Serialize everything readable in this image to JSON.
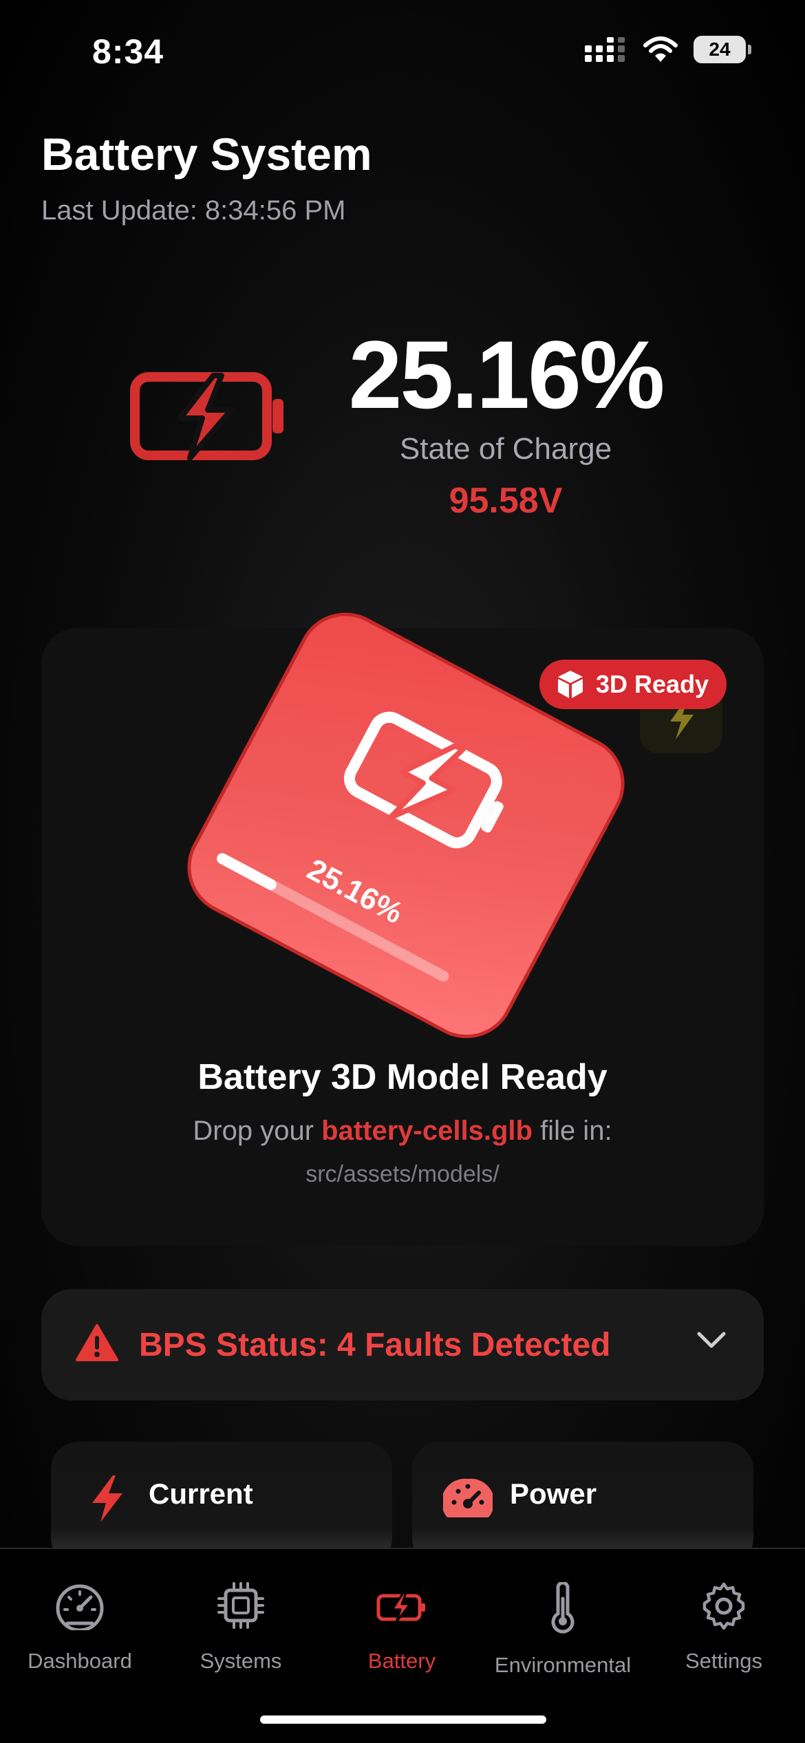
{
  "status_bar": {
    "time": "8:34",
    "battery_level": "24"
  },
  "header": {
    "title": "Battery System",
    "last_update": "Last Update: 8:34:56 PM"
  },
  "soc": {
    "value": "25.16%",
    "label": "State of Charge",
    "voltage": "95.58V"
  },
  "model_card": {
    "badge": "3D Ready",
    "cube_percent": "25.16%",
    "cube_progress": 0.2516,
    "title": "Battery 3D Model Ready",
    "drop_prefix": "Drop your",
    "drop_file": "battery-cells.glb",
    "drop_suffix": "file in:",
    "path": "src/assets/models/"
  },
  "bps": {
    "status": "BPS Status: 4 Faults Detected"
  },
  "metrics": {
    "current_label": "Current",
    "power_label": "Power"
  },
  "tabs": [
    {
      "label": "Dashboard",
      "icon": "gauge-icon"
    },
    {
      "label": "Systems",
      "icon": "cpu-chip-icon"
    },
    {
      "label": "Battery",
      "icon": "battery-charging-icon",
      "active": true
    },
    {
      "label": "Environmental",
      "icon": "thermometer-icon"
    },
    {
      "label": "Settings",
      "icon": "gear-icon"
    }
  ],
  "colors": {
    "accent": "#e03a3a",
    "badge": "#d7282f",
    "cube": "#ef4a4a"
  }
}
